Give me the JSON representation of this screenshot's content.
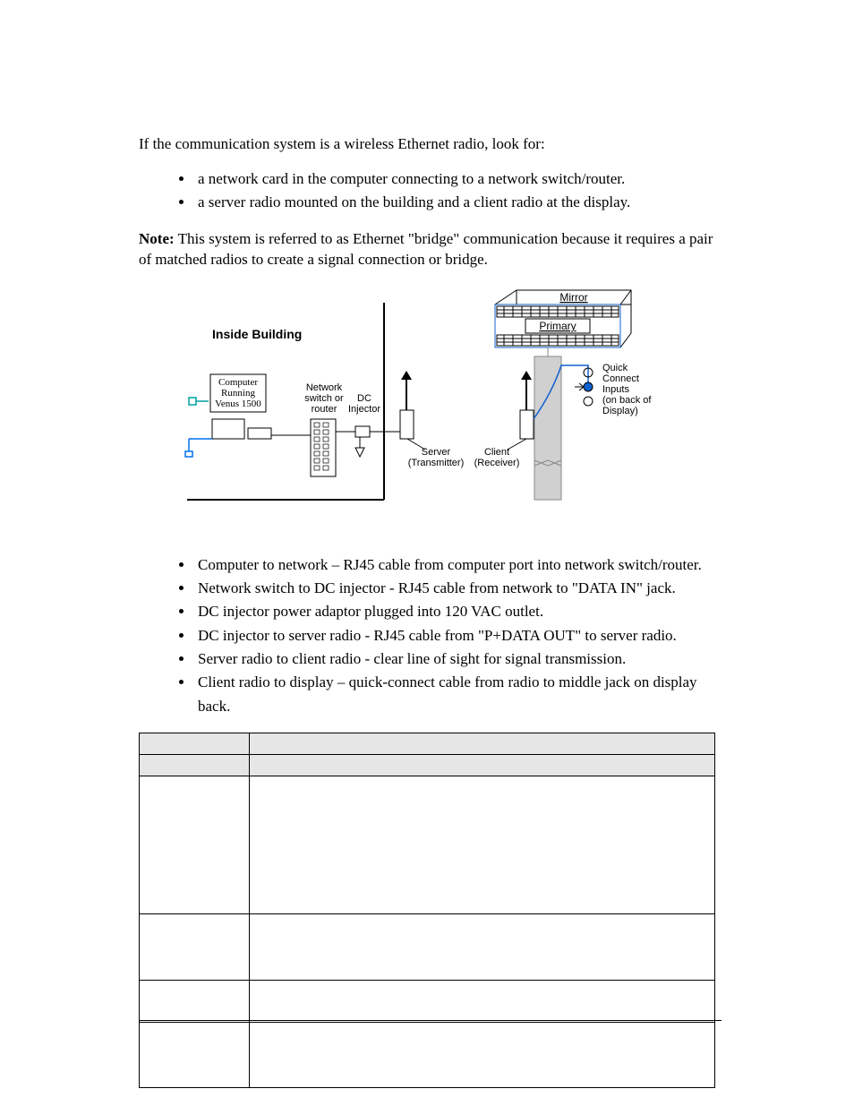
{
  "intro": "If the communication system is a wireless Ethernet radio, look for:",
  "intro_bullets": [
    "a network card in the computer connecting to a network switch/router.",
    "a server radio mounted on the building and a client radio at the display."
  ],
  "note_label": "Note:",
  "note_text": " This system is referred to as Ethernet \"bridge\" communication because it requires a pair of matched radios to create a signal connection or bridge.",
  "figure": {
    "inside_building": "Inside Building",
    "computer_l1": "Computer",
    "computer_l2": "Running",
    "computer_l3": "Venus 1500",
    "network_l1": "Network",
    "network_l2": "switch or",
    "network_l3": "router",
    "dc_l1": "DC",
    "dc_l2": "Injector",
    "server_l1": "Server",
    "server_l2": "(Transmitter)",
    "client_l1": "Client",
    "client_l2": "(Receiver)",
    "qc_l1": "Quick",
    "qc_l2": "Connect",
    "qc_l3": "Inputs",
    "qc_l4": "(on back of",
    "qc_l5": "Display)",
    "mirror": "Mirror",
    "primary": "Primary"
  },
  "conn_bullets": [
    "Computer to network – RJ45 cable from computer port into network switch/router.",
    "Network switch to DC injector - RJ45 cable from network to \"DATA IN\" jack.",
    "DC injector power adaptor plugged into 120 VAC outlet.",
    "DC injector to server radio - RJ45 cable from \"P+DATA OUT\" to server radio.",
    "Server radio to client radio - clear line of sight for signal transmission.",
    "Client radio to display – quick-connect cable from radio to middle jack on display back."
  ],
  "table": {
    "rows": [
      {
        "bullets": 5,
        "spaced": true
      },
      {
        "bullets": 3
      },
      {
        "bullets": 1,
        "tall": true
      },
      {
        "bullets": 3
      }
    ]
  }
}
